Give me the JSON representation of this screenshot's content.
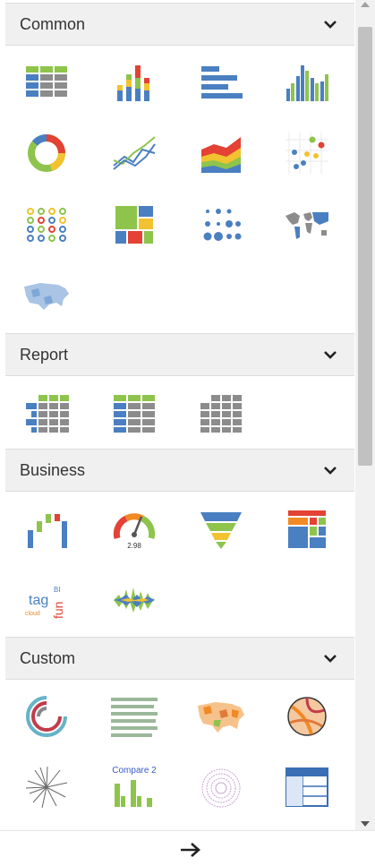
{
  "sections": {
    "common": {
      "label": "Common",
      "icons": [
        "table-chart-icon",
        "stacked-column-chart-icon",
        "bar-chart-icon",
        "column-chart-icon",
        "donut-chart-icon",
        "line-chart-icon",
        "area-chart-icon",
        "scatter-chart-icon",
        "dot-matrix-chart-icon",
        "treemap-chart-icon",
        "bubble-grid-chart-icon",
        "world-map-icon",
        "us-map-icon"
      ]
    },
    "report": {
      "label": "Report",
      "icons": [
        "crosstab-report-icon",
        "table-report-icon",
        "grid-report-icon"
      ]
    },
    "business": {
      "label": "Business",
      "icons": [
        "waterfall-chart-icon",
        "gauge-chart-icon",
        "funnel-chart-icon",
        "heatmap-chart-icon",
        "tag-cloud-icon",
        "stream-chart-icon"
      ]
    },
    "custom": {
      "label": "Custom",
      "icons": [
        "radial-bar-custom-icon",
        "text-list-custom-icon",
        "choropleth-map-custom-icon",
        "chord-diagram-custom-icon",
        "tree-radial-custom-icon",
        "compare-chart-custom-icon",
        "circular-plot-custom-icon",
        "custom-table-icon"
      ]
    }
  },
  "gauge_value": "2.98",
  "tag_cloud": {
    "word1": "tag",
    "word2": "fun",
    "word3": "cloud",
    "word4": "BI"
  },
  "compare_label": "Compare 2",
  "colors": {
    "blue": "#4a7fc1",
    "green": "#8ec44c",
    "yellow": "#f2c230",
    "orange": "#f08a24",
    "red": "#e34234",
    "gray": "#8c8c8c"
  }
}
